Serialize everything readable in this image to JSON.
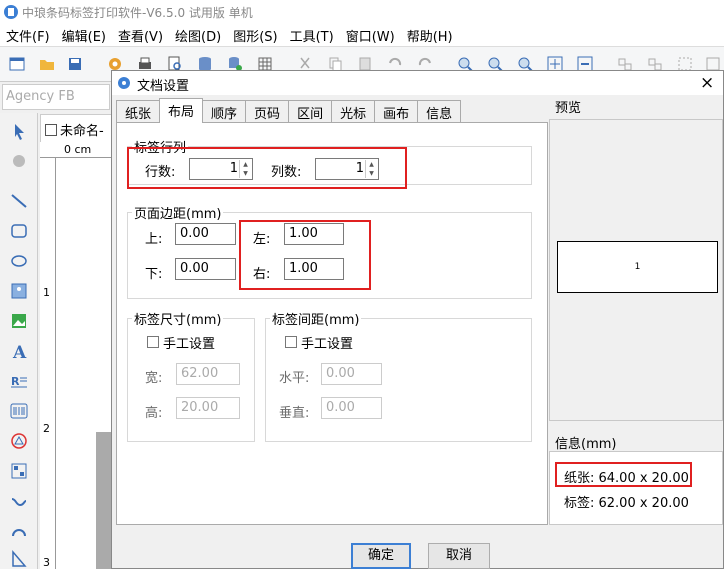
{
  "app": {
    "title": "中琅条码标签打印软件-V6.5.0 试用版 单机"
  },
  "menu": {
    "items": [
      "文件(F)",
      "编辑(E)",
      "查看(V)",
      "绘图(D)",
      "图形(S)",
      "工具(T)",
      "窗口(W)",
      "帮助(H)"
    ]
  },
  "font_box": {
    "value": "Agency FB"
  },
  "document_tab": {
    "label": "未命名-"
  },
  "ruler": {
    "h_label": "0 cm",
    "v_marks": [
      "1",
      "2",
      "3"
    ]
  },
  "dialog": {
    "title": "文档设置",
    "close": "×",
    "tabs": [
      "纸张",
      "布局",
      "顺序",
      "页码",
      "区间",
      "光标",
      "画布",
      "信息"
    ],
    "active_tab": "布局",
    "label_rows_cols": {
      "legend": "标签行列",
      "rows_label": "行数:",
      "rows_value": "1",
      "cols_label": "列数:",
      "cols_value": "1"
    },
    "margins": {
      "legend": "页面边距(mm)",
      "top_label": "上:",
      "top_value": "0.00",
      "bottom_label": "下:",
      "bottom_value": "0.00",
      "left_label": "左:",
      "left_value": "1.00",
      "right_label": "右:",
      "right_value": "1.00"
    },
    "label_size": {
      "legend": "标签尺寸(mm)",
      "manual_label": "手工设置",
      "width_label": "宽:",
      "width_value": "62.00",
      "height_label": "高:",
      "height_value": "20.00"
    },
    "label_gap": {
      "legend": "标签间距(mm)",
      "manual_label": "手工设置",
      "horizontal_label": "水平:",
      "horizontal_value": "0.00",
      "vertical_label": "垂直:",
      "vertical_value": "0.00"
    },
    "preview": {
      "title": "预览",
      "label_number": "1"
    },
    "info": {
      "title": "信息(mm)",
      "paper": "纸张: 64.00 x 20.00",
      "label": "标签: 62.00 x 20.00"
    },
    "buttons": {
      "ok": "确定",
      "cancel": "取消"
    }
  },
  "colors": {
    "highlight": "#e02020",
    "focus": "#3c7fd4"
  }
}
